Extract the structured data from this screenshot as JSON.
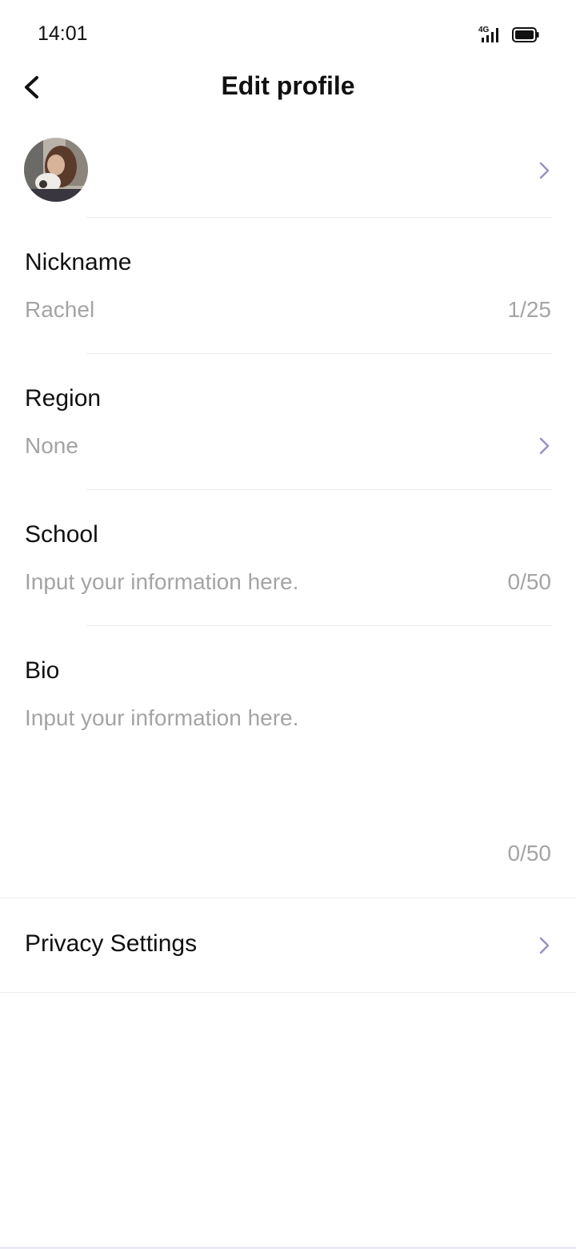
{
  "status_bar": {
    "time": "14:01",
    "network": "4G"
  },
  "header": {
    "title": "Edit profile"
  },
  "fields": {
    "nickname": {
      "label": "Nickname",
      "value": "Rachel",
      "count": "1/25"
    },
    "region": {
      "label": "Region",
      "value": "None"
    },
    "school": {
      "label": "School",
      "placeholder": "Input your information here.",
      "count": "0/50"
    },
    "bio": {
      "label": "Bio",
      "placeholder": "Input your information here.",
      "count": "0/50"
    }
  },
  "privacy": {
    "label": "Privacy Settings"
  },
  "icons": {
    "back": "back-arrow-icon",
    "chevron": "chevron-right-icon"
  },
  "colors": {
    "chevron": "#9a90c4",
    "placeholder": "#a4a4a4",
    "divider": "#ececec"
  }
}
